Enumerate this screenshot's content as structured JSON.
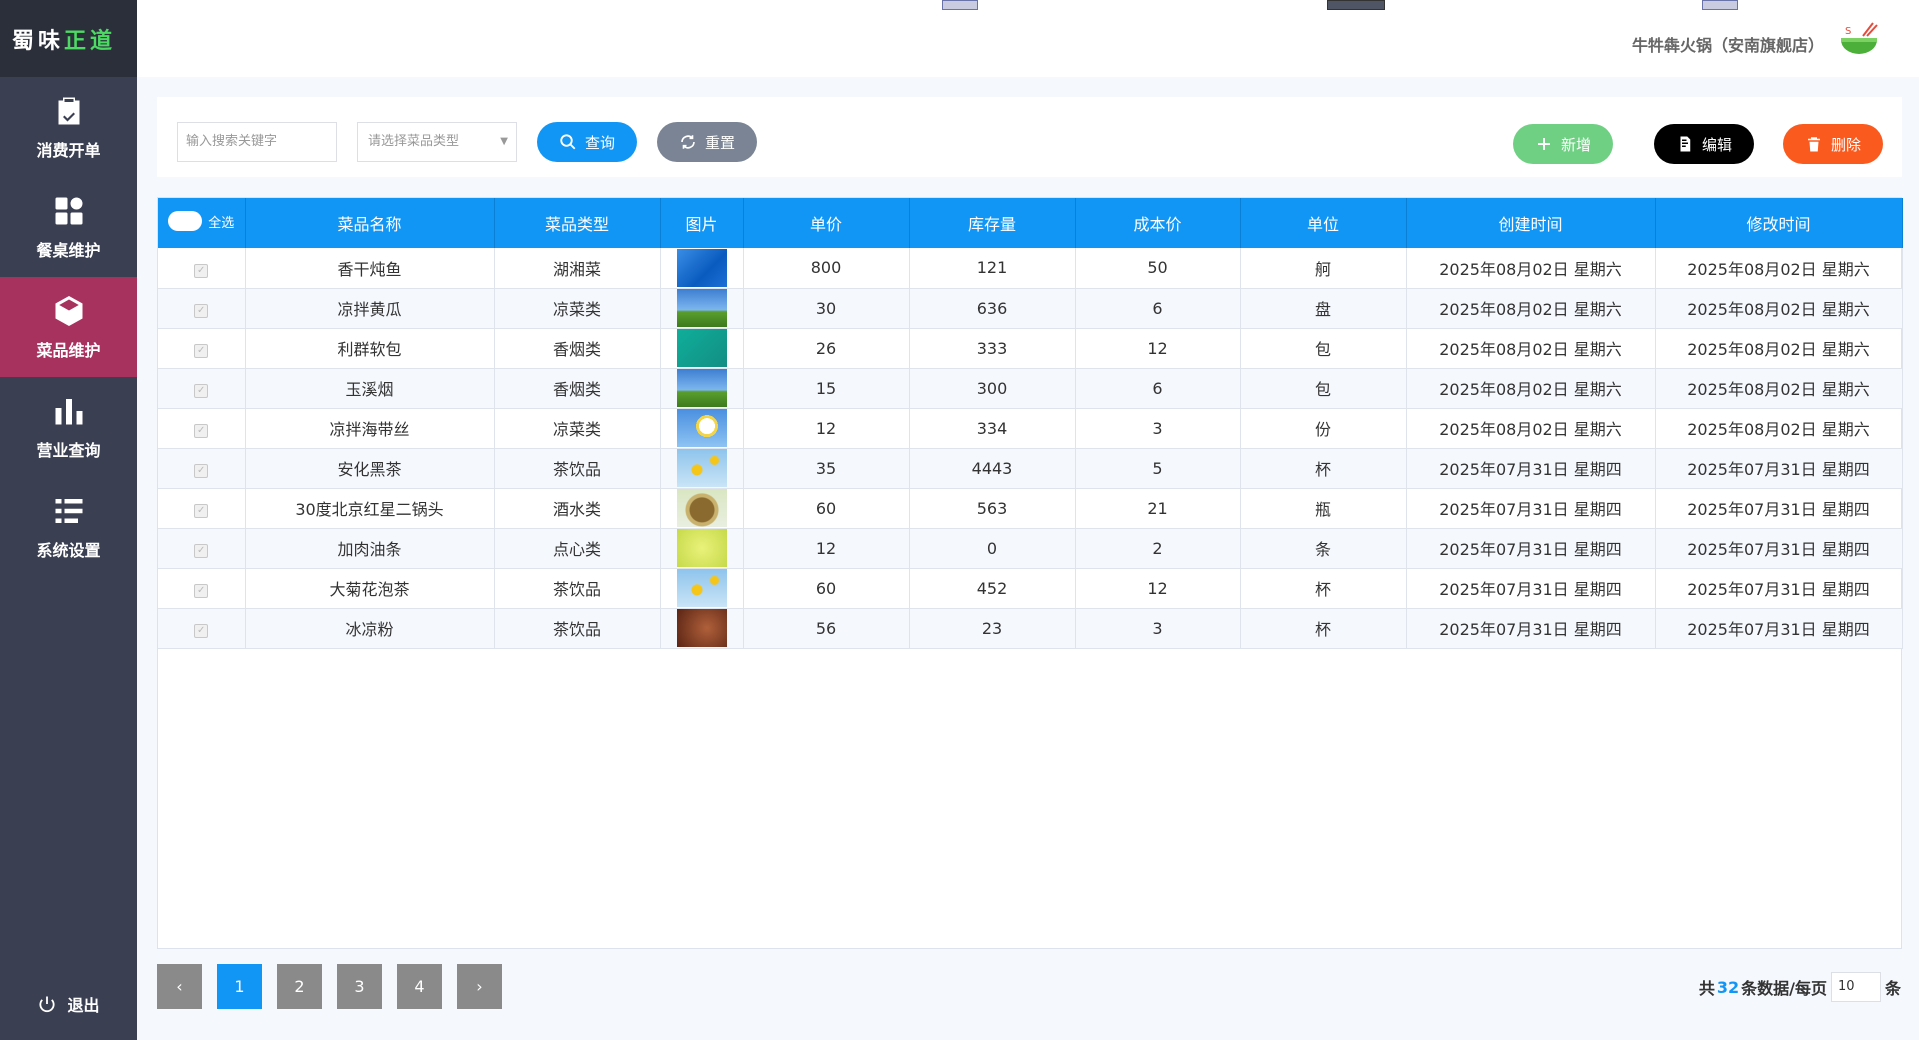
{
  "logo": {
    "part1": "蜀味",
    "part2": "正道"
  },
  "nav": {
    "items": [
      {
        "label": "消费开单",
        "icon": "clipboard-check-icon"
      },
      {
        "label": "餐桌维护",
        "icon": "grid-icon"
      },
      {
        "label": "菜品维护",
        "icon": "cube-icon",
        "active": true
      },
      {
        "label": "营业查询",
        "icon": "bar-chart-icon"
      },
      {
        "label": "系统设置",
        "icon": "list-settings-icon"
      }
    ],
    "logout": "退出"
  },
  "header": {
    "shop_name": "牛牪犇火锅（安南旗舰店）"
  },
  "toolbar": {
    "search_placeholder": "输入搜索关键字",
    "type_placeholder": "请选择菜品类型",
    "query": "查询",
    "reset": "重置",
    "add": "新增",
    "edit": "编辑",
    "delete": "删除"
  },
  "table": {
    "select_all": "全选",
    "columns": [
      "菜品名称",
      "菜品类型",
      "图片",
      "单价",
      "库存量",
      "成本价",
      "单位",
      "创建时间",
      "修改时间"
    ],
    "rows": [
      {
        "name": "香干炖鱼",
        "type": "湖湘菜",
        "price": "800",
        "stock": "121",
        "cost": "50",
        "unit": "舸",
        "created": "2025年08月02日 星期六",
        "modified": "2025年08月02日 星期六",
        "img": "windows"
      },
      {
        "name": "凉拌黄瓜",
        "type": "凉菜类",
        "price": "30",
        "stock": "636",
        "cost": "6",
        "unit": "盘",
        "created": "2025年08月02日 星期六",
        "modified": "2025年08月02日 星期六",
        "img": "grass"
      },
      {
        "name": "利群软包",
        "type": "香烟类",
        "price": "26",
        "stock": "333",
        "cost": "12",
        "unit": "包",
        "created": "2025年08月02日 星期六",
        "modified": "2025年08月02日 星期六",
        "img": "teal"
      },
      {
        "name": "玉溪烟",
        "type": "香烟类",
        "price": "15",
        "stock": "300",
        "cost": "6",
        "unit": "包",
        "created": "2025年08月02日 星期六",
        "modified": "2025年08月02日 星期六",
        "img": "grass"
      },
      {
        "name": "凉拌海带丝",
        "type": "凉菜类",
        "price": "12",
        "stock": "334",
        "cost": "3",
        "unit": "份",
        "created": "2025年08月02日 星期六",
        "modified": "2025年08月02日 星期六",
        "img": "daisy"
      },
      {
        "name": "安化黑茶",
        "type": "茶饮品",
        "price": "35",
        "stock": "4443",
        "cost": "5",
        "unit": "杯",
        "created": "2025年07月31日 星期四",
        "modified": "2025年07月31日 星期四",
        "img": "sunflower"
      },
      {
        "name": "30度北京红星二锅头",
        "type": "酒水类",
        "price": "60",
        "stock": "563",
        "cost": "21",
        "unit": "瓶",
        "created": "2025年07月31日 星期四",
        "modified": "2025年07月31日 星期四",
        "img": "basket"
      },
      {
        "name": "加肉油条",
        "type": "点心类",
        "price": "12",
        "stock": "0",
        "cost": "2",
        "unit": "条",
        "created": "2025年07月31日 星期四",
        "modified": "2025年07月31日 星期四",
        "img": "yellow"
      },
      {
        "name": "大菊花泡茶",
        "type": "茶饮品",
        "price": "60",
        "stock": "452",
        "cost": "12",
        "unit": "杯",
        "created": "2025年07月31日 星期四",
        "modified": "2025年07月31日 星期四",
        "img": "sunflower"
      },
      {
        "name": "冰凉粉",
        "type": "茶饮品",
        "price": "56",
        "stock": "23",
        "cost": "3",
        "unit": "杯",
        "created": "2025年07月31日 星期四",
        "modified": "2025年07月31日 星期四",
        "img": "brown"
      }
    ]
  },
  "pagination": {
    "pages": [
      "1",
      "2",
      "3",
      "4"
    ],
    "current": "1",
    "prev": "‹",
    "next": "›",
    "total_prefix": "共",
    "total": "32",
    "total_suffix": "条数据/每页",
    "page_size": "10",
    "unit": "条"
  },
  "colors": {
    "primary": "#1296f5",
    "sidebar": "#3a3f51",
    "active_nav": "#a8325e",
    "add": "#6fd083",
    "delete": "#fa5a1e"
  }
}
